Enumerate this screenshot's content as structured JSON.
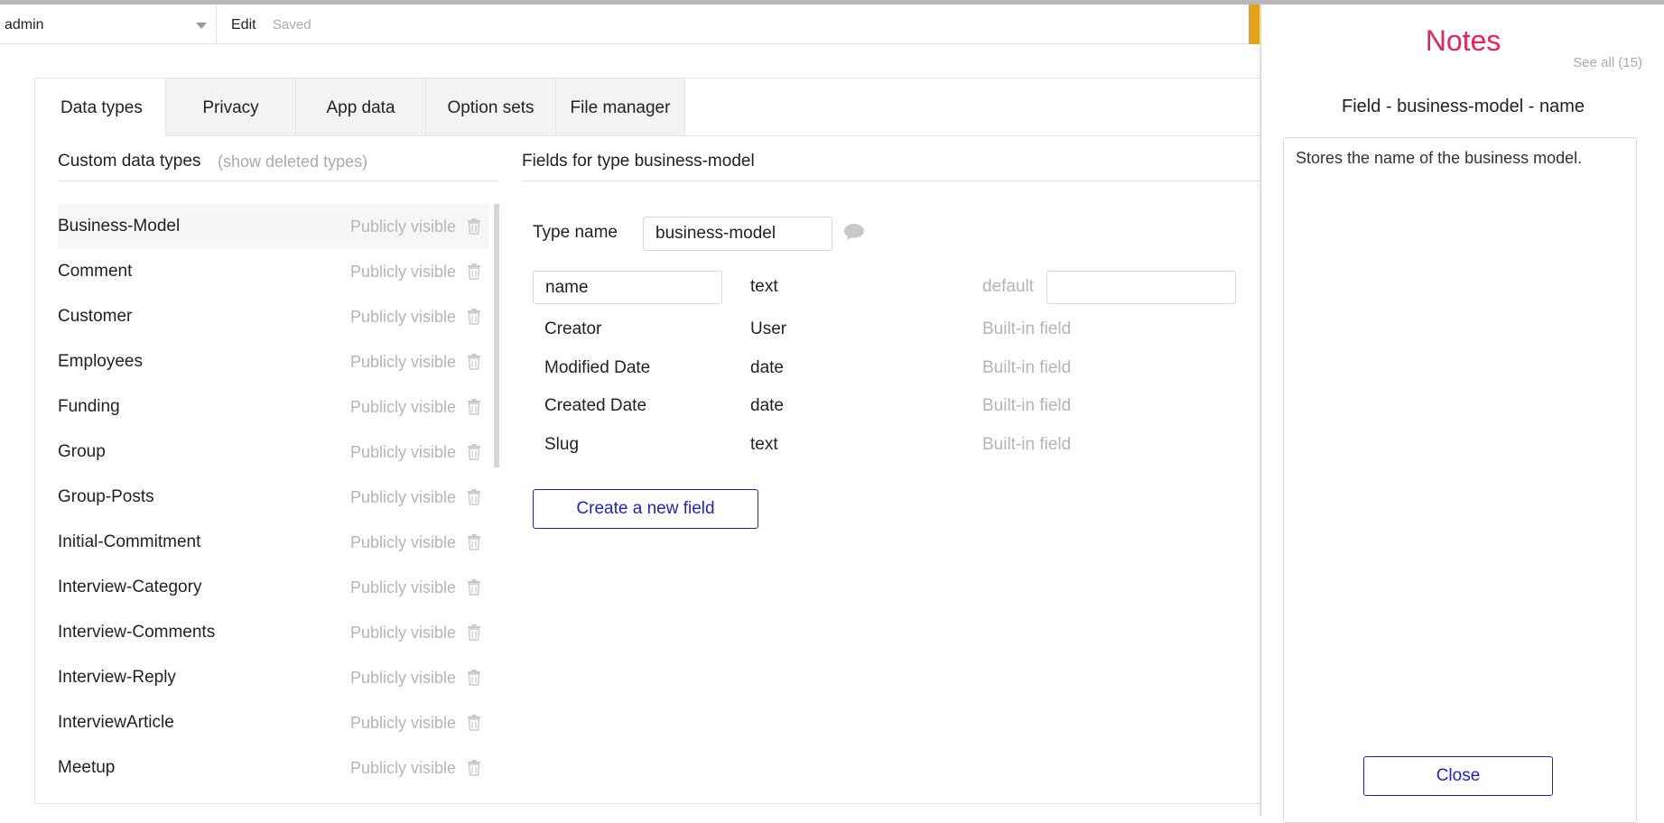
{
  "topbar": {
    "page_name": "admin",
    "mode_label": "Edit",
    "save_status": "Saved"
  },
  "tabs": [
    {
      "label": "Data types",
      "active": true
    },
    {
      "label": "Privacy",
      "active": false
    },
    {
      "label": "App data",
      "active": false
    },
    {
      "label": "Option sets",
      "active": false
    },
    {
      "label": "File manager",
      "active": false
    }
  ],
  "data_types": {
    "header": "Custom data types",
    "show_deleted_label": "(show deleted types)",
    "items": [
      {
        "name": "Business-Model",
        "visibility": "Publicly visible",
        "selected": true
      },
      {
        "name": "Comment",
        "visibility": "Publicly visible"
      },
      {
        "name": "Customer",
        "visibility": "Publicly visible"
      },
      {
        "name": "Employees",
        "visibility": "Publicly visible"
      },
      {
        "name": "Funding",
        "visibility": "Publicly visible"
      },
      {
        "name": "Group",
        "visibility": "Publicly visible"
      },
      {
        "name": "Group-Posts",
        "visibility": "Publicly visible"
      },
      {
        "name": "Initial-Commitment",
        "visibility": "Publicly visible"
      },
      {
        "name": "Interview-Category",
        "visibility": "Publicly visible"
      },
      {
        "name": "Interview-Comments",
        "visibility": "Publicly visible"
      },
      {
        "name": "Interview-Reply",
        "visibility": "Publicly visible"
      },
      {
        "name": "InterviewArticle",
        "visibility": "Publicly visible"
      },
      {
        "name": "Meetup",
        "visibility": "Publicly visible"
      }
    ]
  },
  "fields_panel": {
    "header": "Fields for type business-model",
    "type_name_label": "Type name",
    "type_name_value": "business-model",
    "custom_field": {
      "name": "name",
      "type": "text",
      "default_label": "default",
      "default_value": ""
    },
    "builtin_fields": [
      {
        "name": "Creator",
        "type": "User",
        "note": "Built-in field"
      },
      {
        "name": "Modified Date",
        "type": "date",
        "note": "Built-in field"
      },
      {
        "name": "Created Date",
        "type": "date",
        "note": "Built-in field"
      },
      {
        "name": "Slug",
        "type": "text",
        "note": "Built-in field"
      }
    ],
    "create_button_label": "Create a new field"
  },
  "notes": {
    "title": "Notes",
    "see_all_label": "See all (15)",
    "subtitle": "Field - business-model - name",
    "text": "Stores the name of the business model.",
    "close_label": "Close",
    "title_color": "#e8245d",
    "button_color": "#1f25b6"
  }
}
